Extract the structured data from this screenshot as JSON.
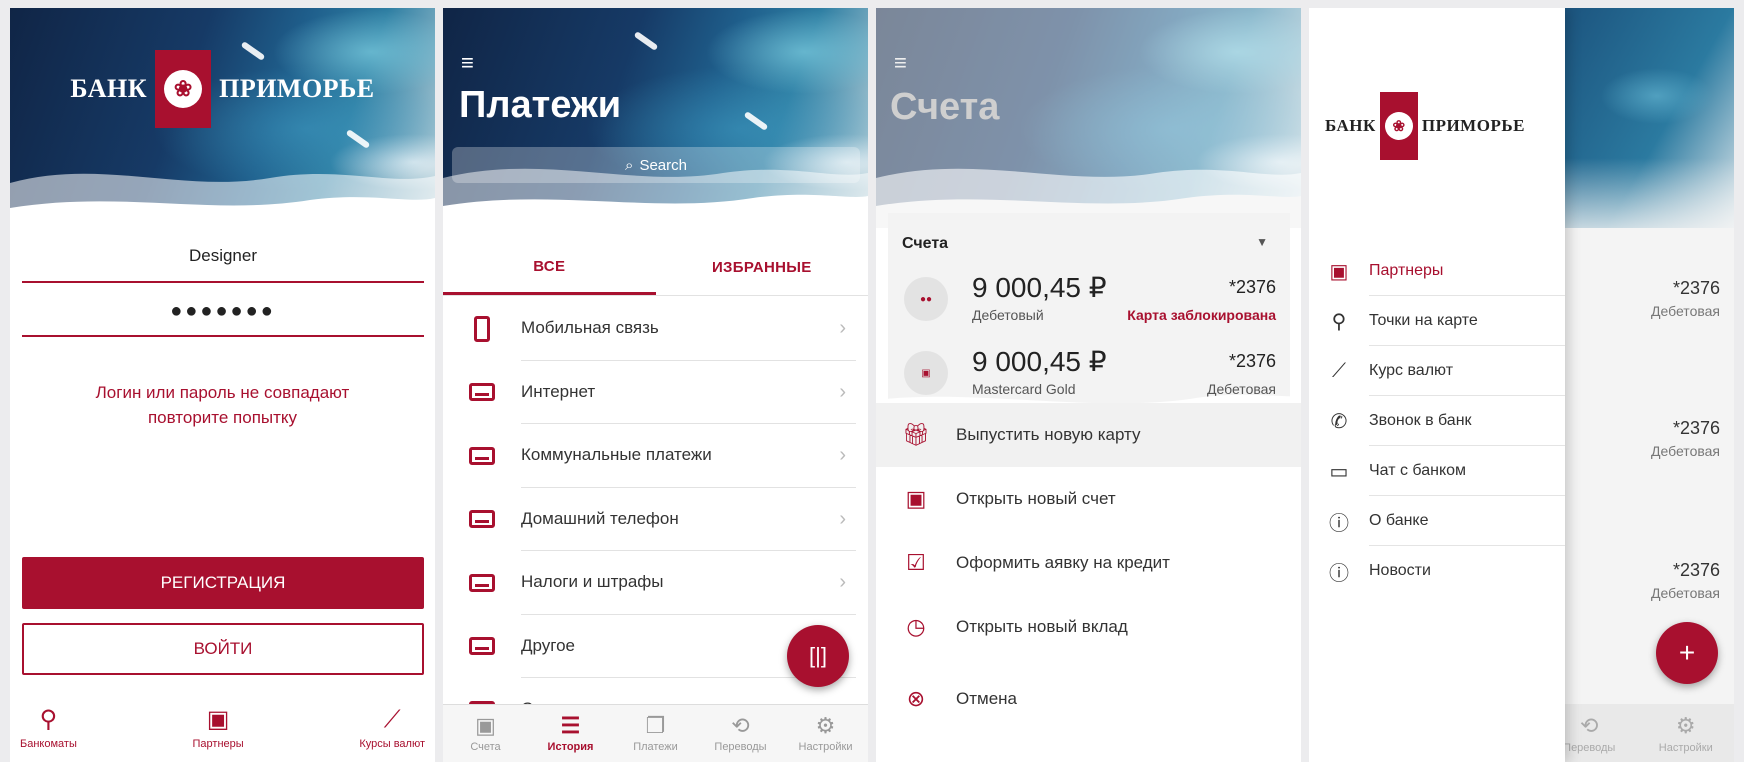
{
  "brand": {
    "word_left": "БАНК",
    "word_right": "ПРИМОРЬЕ",
    "emblem": "bank-emblem-icon"
  },
  "colors": {
    "accent": "#a8102f",
    "muted": "#999999"
  },
  "login": {
    "username": "Designer",
    "password_mask": "●●●●●●●",
    "error_line1": "Логин или пароль не совпадают",
    "error_line2": "повторите попытку",
    "register_label": "РЕГИСТРАЦИЯ",
    "login_label": "ВОЙТИ",
    "nav": [
      {
        "label": "Банкоматы",
        "icon": "map-pin-icon"
      },
      {
        "label": "Партнеры",
        "icon": "partner-icon"
      },
      {
        "label": "Курсы валют",
        "icon": "trend-icon"
      }
    ]
  },
  "payments": {
    "title": "Платежи",
    "search_placeholder": "Search",
    "tabs": [
      {
        "label": "ВСЕ"
      },
      {
        "label": "ИЗБРАННЫЕ"
      }
    ],
    "items": [
      {
        "label": "Мобильная связь",
        "icon": "phone-icon"
      },
      {
        "label": "Интернет",
        "icon": "card-icon"
      },
      {
        "label": "Коммунальные платежи",
        "icon": "card-icon"
      },
      {
        "label": "Домашний телефон",
        "icon": "card-icon"
      },
      {
        "label": "Налоги и штрафы",
        "icon": "card-icon"
      },
      {
        "label": "Другое",
        "icon": "card-icon"
      },
      {
        "label": "Создать автоплатеж",
        "icon": "card-icon"
      }
    ],
    "nav": [
      {
        "label": "Счета",
        "icon": "wallet-icon"
      },
      {
        "label": "История",
        "icon": "list-icon"
      },
      {
        "label": "Платежи",
        "icon": "cards-icon"
      },
      {
        "label": "Переводы",
        "icon": "sync-icon"
      },
      {
        "label": "Настройки",
        "icon": "gear-icon"
      }
    ]
  },
  "accounts": {
    "title": "Счета",
    "section_label": "Счета",
    "rows": [
      {
        "amount": "9 000,45 ₽",
        "type": "Дебетовый",
        "number": "*2376",
        "status": "Карта заблокирована"
      },
      {
        "amount": "9 000,45 ₽",
        "type": "Mastercard Gold",
        "number": "*2376",
        "status": "Дебетовая"
      }
    ],
    "actions": [
      {
        "label": "Выпустить новую карту",
        "icon": "gift-card-icon"
      },
      {
        "label": "Открыть новый счет",
        "icon": "wallet-icon"
      },
      {
        "label": "Оформить аявку на кредит",
        "icon": "clipboard-check-icon"
      },
      {
        "label": "Открыть новый вклад",
        "icon": "clock-icon"
      },
      {
        "label": "Отмена",
        "icon": "cancel-icon"
      }
    ]
  },
  "drawer": {
    "items": [
      {
        "label": "Партнеры",
        "icon": "partner-icon"
      },
      {
        "label": "Точки на карте",
        "icon": "map-pin-icon"
      },
      {
        "label": "Курс валют",
        "icon": "trend-icon"
      },
      {
        "label": "Звонок в банк",
        "icon": "phone-icon"
      },
      {
        "label": "Чат с банком",
        "icon": "chat-icon"
      },
      {
        "label": "О банке",
        "icon": "info-icon"
      },
      {
        "label": "Новости",
        "icon": "info-icon"
      }
    ],
    "background_rows": [
      {
        "number": "*2376",
        "type": "Дебетовая"
      },
      {
        "number": "*2376",
        "type": "Дебетовая"
      },
      {
        "number": "*2376",
        "type": "Дебетовая"
      }
    ],
    "fab_label": "+",
    "nav": [
      {
        "label": "Переводы",
        "icon": "sync-icon"
      },
      {
        "label": "Настройки",
        "icon": "gear-icon"
      }
    ]
  }
}
